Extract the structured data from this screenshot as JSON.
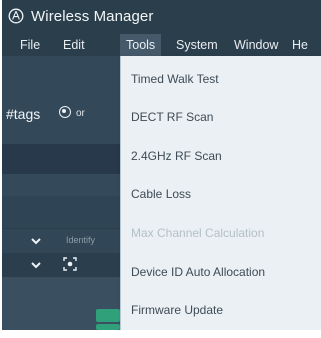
{
  "window": {
    "title": "Wireless Manager",
    "logo_icon": "audio-technica-logo-icon"
  },
  "menubar": {
    "items": [
      {
        "label": "File"
      },
      {
        "label": "Edit"
      },
      {
        "label": "Tools",
        "active": true
      },
      {
        "label": "System"
      },
      {
        "label": "Window"
      },
      {
        "label": "He"
      }
    ]
  },
  "toolbar": {
    "tags_label": "#tags",
    "radio_icon": "radio-selected-icon",
    "or_label": "or"
  },
  "tree": {
    "identify_label": "Identify",
    "chevron_icon": "chevron-down-icon",
    "identify_icon": "identify-target-icon"
  },
  "tools_menu": {
    "items": [
      {
        "label": "Timed Walk Test",
        "enabled": true
      },
      {
        "label": "DECT RF Scan",
        "enabled": true
      },
      {
        "label": "2.4GHz RF Scan",
        "enabled": true
      },
      {
        "label": "Cable Loss",
        "enabled": true
      },
      {
        "label": "Max Channel Calculation",
        "enabled": false
      },
      {
        "label": "Device ID Auto Allocation",
        "enabled": true
      },
      {
        "label": "Firmware Update",
        "enabled": true
      }
    ]
  },
  "colors": {
    "app_bg": "#2b3e4b",
    "menu_bg": "#eaf0f4",
    "accent_green": "#2fa07a",
    "disabled_text": "#b5c0c7"
  }
}
